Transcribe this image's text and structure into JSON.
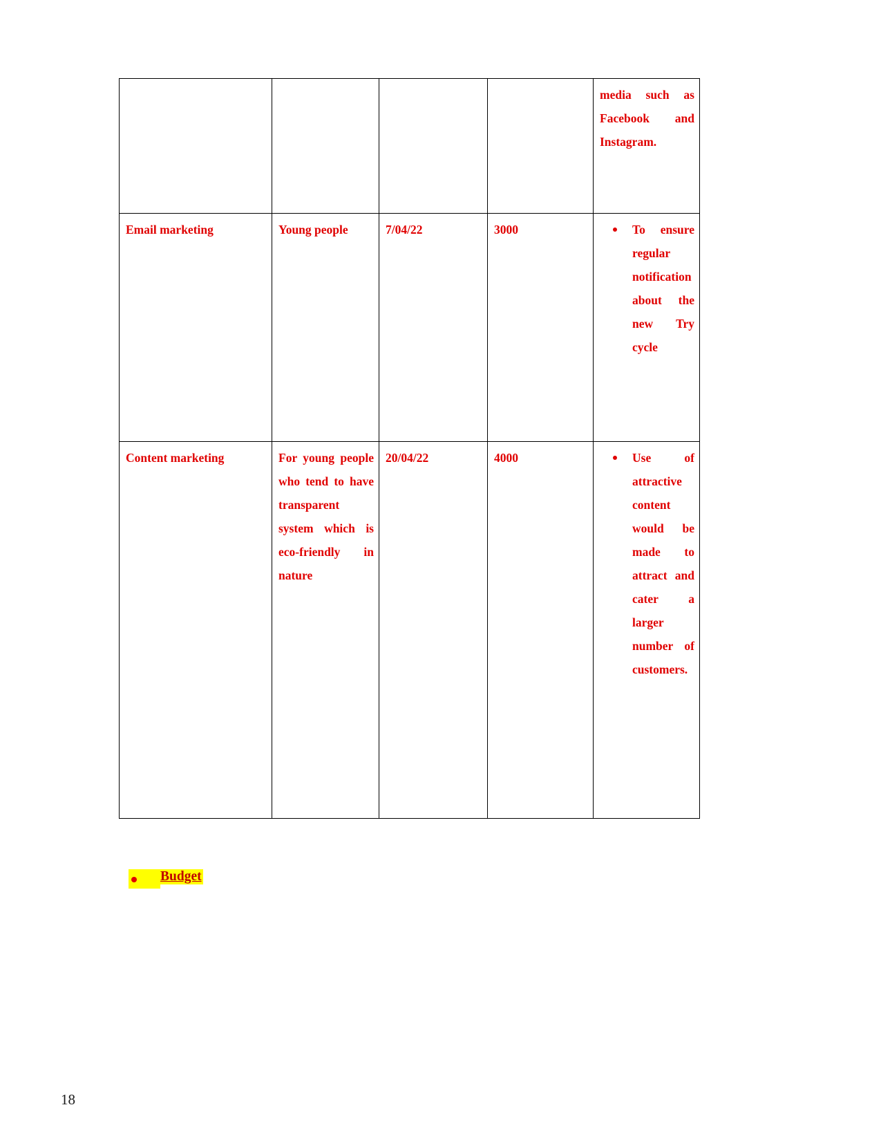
{
  "document": {
    "page_number": "18",
    "text_color": "#e00000",
    "highlight_color": "#ffff00"
  },
  "table": {
    "rows": [
      {
        "channel": "",
        "audience": "",
        "date": "",
        "budget": "",
        "description_continued": "media such as Facebook and Instagram."
      },
      {
        "channel": "Email marketing",
        "audience": "Young people",
        "date": "7/04/22",
        "budget": "3000",
        "bullets": [
          "To ensure regular notification about the new Try cycle"
        ]
      },
      {
        "channel": "Content marketing",
        "audience": "For young people who tend to have transparent system which is eco-friendly in nature",
        "date": "20/04/22",
        "budget": "4000",
        "bullets": [
          "Use of attractive content would be made to attract and cater a larger number of customers."
        ]
      }
    ]
  },
  "below_table": {
    "budget_heading": "Budget "
  }
}
